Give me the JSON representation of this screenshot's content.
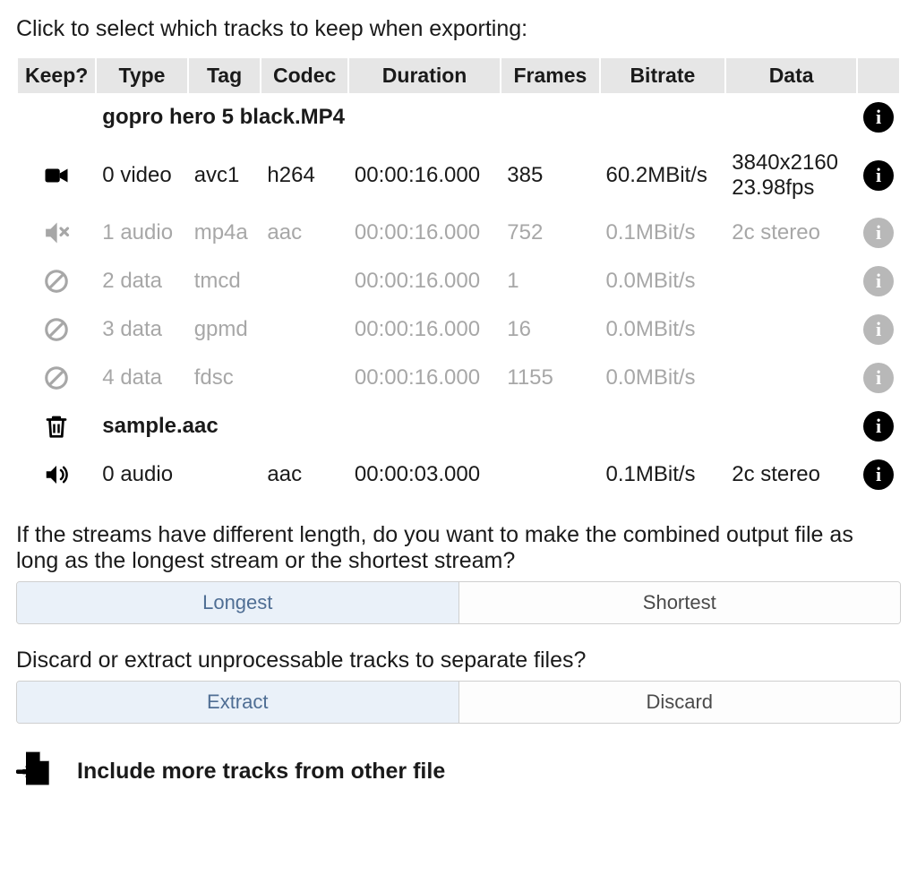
{
  "instruction": "Click to select which tracks to keep when exporting:",
  "columns": {
    "keep": "Keep?",
    "type": "Type",
    "tag": "Tag",
    "codec": "Codec",
    "duration": "Duration",
    "frames": "Frames",
    "bitrate": "Bitrate",
    "data": "Data"
  },
  "files": [
    {
      "name": "gopro hero 5 black.MP4",
      "delete_icon": false,
      "tracks": [
        {
          "active": true,
          "icon": "video",
          "index": "0",
          "type": "video",
          "tag": "avc1",
          "codec": "h264",
          "duration": "00:00:16.000",
          "frames": "385",
          "bitrate": "60.2MBit/s",
          "data_line1": "3840x2160",
          "data_line2": "23.98fps"
        },
        {
          "active": false,
          "icon": "muted",
          "index": "1",
          "type": "audio",
          "tag": "mp4a",
          "codec": "aac",
          "duration": "00:00:16.000",
          "frames": "752",
          "bitrate": "0.1MBit/s",
          "data_line1": "2c stereo",
          "data_line2": ""
        },
        {
          "active": false,
          "icon": "disabled",
          "index": "2",
          "type": "data",
          "tag": "tmcd",
          "codec": "",
          "duration": "00:00:16.000",
          "frames": "1",
          "bitrate": "0.0MBit/s",
          "data_line1": "",
          "data_line2": ""
        },
        {
          "active": false,
          "icon": "disabled",
          "index": "3",
          "type": "data",
          "tag": "gpmd",
          "codec": "",
          "duration": "00:00:16.000",
          "frames": "16",
          "bitrate": "0.0MBit/s",
          "data_line1": "",
          "data_line2": ""
        },
        {
          "active": false,
          "icon": "disabled",
          "index": "4",
          "type": "data",
          "tag": "fdsc",
          "codec": "",
          "duration": "00:00:16.000",
          "frames": "1155",
          "bitrate": "0.0MBit/s",
          "data_line1": "",
          "data_line2": ""
        }
      ]
    },
    {
      "name": "sample.aac",
      "delete_icon": true,
      "tracks": [
        {
          "active": true,
          "icon": "speaker",
          "index": "0",
          "type": "audio",
          "tag": "",
          "codec": "aac",
          "duration": "00:00:03.000",
          "frames": "",
          "bitrate": "0.1MBit/s",
          "data_line1": "2c stereo",
          "data_line2": ""
        }
      ]
    }
  ],
  "length_question": "If the streams have different length, do you want to make the combined output file as long as the longest stream or the shortest stream?",
  "length_options": {
    "longest": "Longest",
    "shortest": "Shortest",
    "selected": "longest"
  },
  "discard_question": "Discard or extract unprocessable tracks to separate files?",
  "discard_options": {
    "extract": "Extract",
    "discard": "Discard",
    "selected": "extract"
  },
  "include_more": "Include more tracks from other file"
}
